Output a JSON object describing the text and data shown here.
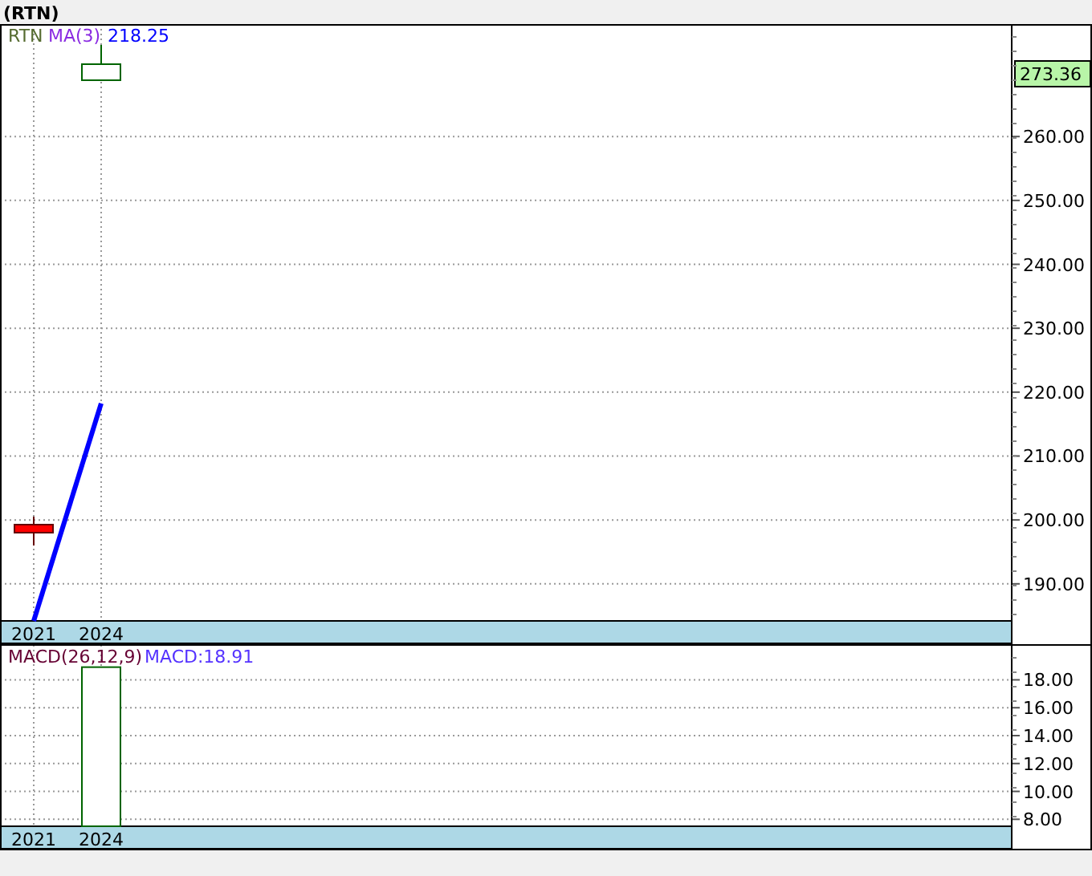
{
  "title": "(RTN)",
  "price_panel": {
    "symbol": "RTN",
    "indicator_value": "218.25",
    "last_price": "273.36",
    "chart_data": {
      "type": "line",
      "x": [
        2021,
        2024
      ],
      "xlim": [
        2019.5,
        2064.5
      ],
      "xticks": [
        2021,
        2024
      ],
      "ylim": [
        184.2,
        277.6
      ],
      "grid": true,
      "series": [
        {
          "name": "MA(3)",
          "color": "#0000ff",
          "values": [
            184.2,
            218.25
          ]
        }
      ],
      "yticks": [
        {
          "value": 190,
          "label": "190.00"
        },
        {
          "value": 200,
          "label": "200.00"
        },
        {
          "value": 210,
          "label": "210.00"
        },
        {
          "value": 220,
          "label": "220.00"
        },
        {
          "value": 230,
          "label": "230.00"
        },
        {
          "value": 240,
          "label": "240.00"
        },
        {
          "value": 250,
          "label": "250.00"
        },
        {
          "value": 260,
          "label": "260.00"
        }
      ]
    }
  },
  "macd_panel": {
    "label": "MACD(26,12,9)",
    "value_label": "MACD:18.91",
    "chart_data": {
      "type": "bar",
      "x": [
        2024
      ],
      "xlim": [
        2019.5,
        2064.5
      ],
      "xticks": [
        2021,
        2024
      ],
      "ylim": [
        7.5,
        20.5
      ],
      "grid": true,
      "series": [
        {
          "color": "#ffffff",
          "values": [
            18.91
          ]
        }
      ],
      "yticks": [
        {
          "value": 8,
          "label": "8.00"
        },
        {
          "value": 10,
          "label": "10.00"
        },
        {
          "value": 12,
          "label": "12.00"
        },
        {
          "value": 14,
          "label": "14.00"
        },
        {
          "value": 16,
          "label": "16.00"
        },
        {
          "value": 18,
          "label": "18.00"
        }
      ]
    }
  }
}
